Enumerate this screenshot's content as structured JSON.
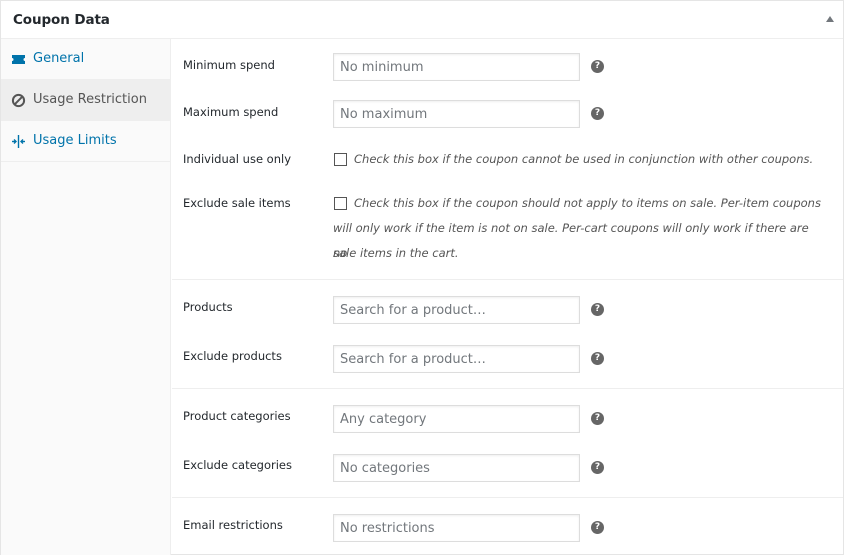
{
  "panel": {
    "title": "Coupon Data"
  },
  "tabs": [
    {
      "label": "General",
      "icon": "ticket-icon"
    },
    {
      "label": "Usage Restriction",
      "icon": "no-entry-icon"
    },
    {
      "label": "Usage Limits",
      "icon": "limits-icon"
    }
  ],
  "fields": {
    "minimum_spend": {
      "label": "Minimum spend",
      "placeholder": "No minimum"
    },
    "maximum_spend": {
      "label": "Maximum spend",
      "placeholder": "No maximum"
    },
    "individual_use": {
      "label": "Individual use only",
      "description": "Check this box if the coupon cannot be used in conjunction with other coupons."
    },
    "exclude_sale": {
      "label": "Exclude sale items",
      "description_line1": "Check this box if the coupon should not apply to items on sale. Per-item coupons",
      "description_line2": "will only work if the item is not on sale. Per-cart coupons will only work if there are no",
      "description_line3": "sale items in the cart."
    },
    "products": {
      "label": "Products",
      "placeholder": "Search for a product…"
    },
    "exclude_products": {
      "label": "Exclude products",
      "placeholder": "Search for a product…"
    },
    "product_categories": {
      "label": "Product categories",
      "placeholder": "Any category"
    },
    "exclude_categories": {
      "label": "Exclude categories",
      "placeholder": "No categories"
    },
    "email_restrictions": {
      "label": "Email restrictions",
      "placeholder": "No restrictions"
    }
  },
  "help_glyph": "?",
  "colors": {
    "link": "#0073aa",
    "active_tab_bg": "#eeeeee",
    "sidebar_bg": "#fafafa"
  }
}
